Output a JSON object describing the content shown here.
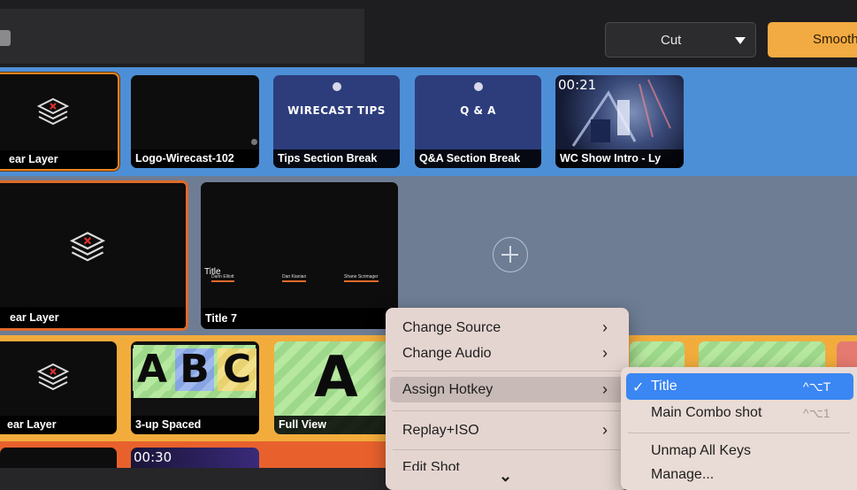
{
  "toolbar": {
    "transition_select": "Cut",
    "transition_button": "Smooth"
  },
  "row1": {
    "shots": [
      {
        "name": "Clear Layer",
        "caption": "ear Layer"
      },
      {
        "name": "Logo-Wirecast",
        "caption": "Logo-Wirecast-102"
      },
      {
        "name": "Tips Section Break",
        "caption": "Tips Section Break",
        "thumb_text": "WIRECAST TIPS"
      },
      {
        "name": "Q&A Section Break",
        "caption": "Q&A Section Break",
        "thumb_text": "Q & A"
      },
      {
        "name": "WC Show Intro",
        "caption": "WC Show Intro - Ly",
        "timer": "00:21"
      }
    ]
  },
  "row2": {
    "shots": [
      {
        "name": "Clear Layer",
        "caption": "ear Layer"
      },
      {
        "name": "Title 7",
        "caption": "Title 7",
        "thumb_title": "Title",
        "names": [
          "Darin Elliott",
          "Dan Kianian",
          "Shane Scrimager"
        ]
      }
    ]
  },
  "row3": {
    "shots": [
      {
        "name": "Clear Layer",
        "caption": "ear Layer"
      },
      {
        "name": "3-up Spaced",
        "caption": "3-up Spaced",
        "letters": [
          "A",
          "B",
          "C"
        ]
      },
      {
        "name": "Full View",
        "caption": "Full View",
        "letter": "A"
      }
    ]
  },
  "row4": {
    "timer": "00:30"
  },
  "context_menu": {
    "items": [
      {
        "label": "Change Source",
        "has_submenu": true
      },
      {
        "label": "Change Audio",
        "has_submenu": true
      },
      {
        "label": "Assign Hotkey",
        "has_submenu": true
      },
      {
        "label": "Replay+ISO",
        "has_submenu": true
      },
      {
        "label": "Edit Shot",
        "has_submenu": false
      }
    ],
    "chevron": "›",
    "scroll_down": "⌄"
  },
  "hotkey_submenu": {
    "items": [
      {
        "label": "Title",
        "checked": true,
        "shortcut": "^⌥T"
      },
      {
        "label": "Main Combo shot",
        "checked": false,
        "shortcut": "^⌥1"
      },
      {
        "label": "Unmap All Keys"
      },
      {
        "label": "Manage..."
      }
    ],
    "checkmark": "✓"
  },
  "colors": {
    "row1": "#4d8fd6",
    "row2": "#6e7d94",
    "row3": "#f2ac3c",
    "row4": "#e8612d",
    "accent": "#3a86f2"
  }
}
